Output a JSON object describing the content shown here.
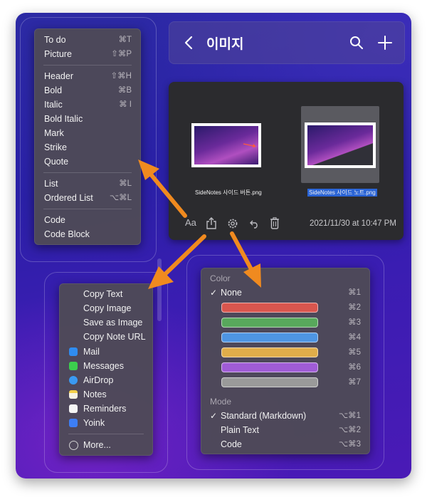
{
  "header": {
    "title": "이미지"
  },
  "format_menu": {
    "items": [
      {
        "label": "To do",
        "shortcut": "⌘T"
      },
      {
        "label": "Picture",
        "shortcut": "⇧⌘P"
      },
      {
        "label": "Header",
        "shortcut": "⇧⌘H"
      },
      {
        "label": "Bold",
        "shortcut": "⌘B"
      },
      {
        "label": "Italic",
        "shortcut": "⌘ I"
      },
      {
        "label": "Bold Italic",
        "shortcut": ""
      },
      {
        "label": "Mark",
        "shortcut": ""
      },
      {
        "label": "Strike",
        "shortcut": ""
      },
      {
        "label": "Quote",
        "shortcut": ""
      },
      {
        "label": "List",
        "shortcut": "⌘L"
      },
      {
        "label": "Ordered List",
        "shortcut": "⌥⌘L"
      },
      {
        "label": "Code",
        "shortcut": ""
      },
      {
        "label": "Code Block",
        "shortcut": ""
      }
    ]
  },
  "card": {
    "images": [
      {
        "caption": "SideNotes 사이드 버튼.png"
      },
      {
        "caption": "SideNotes 사이드 노트.png"
      }
    ],
    "date": "2021/11/30 at 10:47 PM",
    "toolbar_aa": "Aa"
  },
  "share_menu": {
    "items": [
      {
        "label": "Copy Text"
      },
      {
        "label": "Copy Image"
      },
      {
        "label": "Save as Image"
      },
      {
        "label": "Copy Note URL"
      },
      {
        "label": "Mail",
        "icon": "mail-icon",
        "color": "#2f8cf0"
      },
      {
        "label": "Messages",
        "icon": "messages-icon",
        "color": "#3ccf4e"
      },
      {
        "label": "AirDrop",
        "icon": "airdrop-icon",
        "color": "#3a9af2"
      },
      {
        "label": "Notes",
        "icon": "notes-icon",
        "color": "#f4d04a"
      },
      {
        "label": "Reminders",
        "icon": "reminders-icon",
        "color": "#f5f5f5"
      },
      {
        "label": "Yoink",
        "icon": "yoink-icon",
        "color": "#3d7ef5"
      },
      {
        "label": "More...",
        "icon": "more-icon",
        "color": "#d0d0d0"
      }
    ]
  },
  "settings_menu": {
    "color_header": "Color",
    "colors": [
      {
        "label": "None",
        "checked": true,
        "shortcut": "⌘1"
      },
      {
        "swatch": "#d9564e",
        "shortcut": "⌘2"
      },
      {
        "swatch": "#58a85c",
        "shortcut": "⌘3"
      },
      {
        "swatch": "#4e95e3",
        "shortcut": "⌘4"
      },
      {
        "swatch": "#e0ad4a",
        "shortcut": "⌘5"
      },
      {
        "swatch": "#a05cd6",
        "shortcut": "⌘6"
      },
      {
        "swatch": "#9a9a9a",
        "shortcut": "⌘7"
      }
    ],
    "mode_header": "Mode",
    "modes": [
      {
        "label": "Standard (Markdown)",
        "checked": true,
        "shortcut": "⌥⌘1"
      },
      {
        "label": "Plain Text",
        "checked": false,
        "shortcut": "⌥⌘2"
      },
      {
        "label": "Code",
        "checked": false,
        "shortcut": "⌥⌘3"
      }
    ]
  },
  "colors": {
    "arrow": "#f08a1f",
    "selection": "#2a64d6"
  }
}
